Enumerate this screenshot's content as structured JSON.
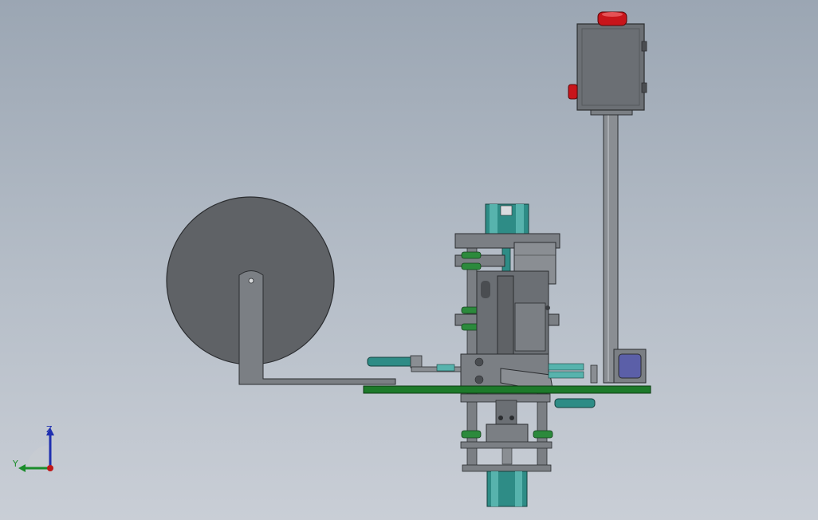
{
  "viewport": {
    "background_top": "#9ba6b3",
    "background_bottom": "#c9ced6"
  },
  "colors": {
    "part_dark_gray": "#5f6266",
    "part_mid_gray": "#7b7f84",
    "part_light_gray": "#9a9ea3",
    "base_plate_green": "#1d7a2a",
    "cylinder_teal": "#2e8c86",
    "cylinder_teal_light": "#57b3ad",
    "bushing_green": "#2c8a3c",
    "warning_light_red": "#c8151b",
    "sensor_blue": "#5b5fa8",
    "outline": "#2b2d30"
  },
  "model": {
    "parts": [
      "reel-disk",
      "reel-support-arm",
      "control-box",
      "warning-light",
      "control-box-pole",
      "base-plate",
      "vertical-press-assembly",
      "top-cylinder",
      "bottom-cylinder",
      "side-cylinder-left",
      "side-cylinder-right",
      "sensor-block"
    ]
  },
  "triad": {
    "z_label": "Z",
    "y_label": "Y",
    "z_color": "#1f2fb0",
    "y_color": "#1a8c2a",
    "x_color": "#c01818"
  }
}
